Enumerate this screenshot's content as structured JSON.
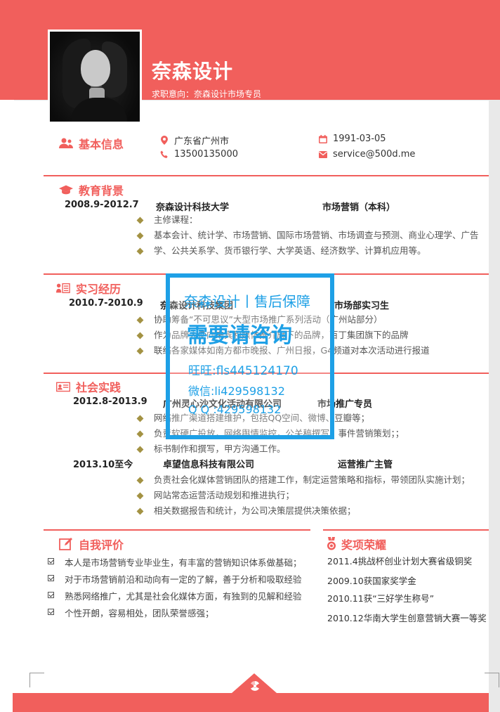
{
  "header": {
    "name": "奈森设计",
    "intent": "求职意向：奈森设计市场专员"
  },
  "colors": {
    "accent": "#f15f5c",
    "bullet": "#a39243",
    "watermark": "#1ea0e6"
  },
  "basic": {
    "title": "基本信息",
    "location": "广东省广州市",
    "birth": "1991-03-05",
    "phone": "13500135000",
    "email": "service@500d.me"
  },
  "education": {
    "title": "教育背景",
    "period": "2008.9-2012.7",
    "school": "奈森设计科技大学",
    "major": "市场营销（本科）",
    "bullets": [
      "主修课程：",
      "基本会计、统计学、市场营销、国际市场营销、市场调查与预测、商业心理学、广告",
      "学、公共关系学、货币银行学、大学英语、经济数学、计算机应用等。"
    ]
  },
  "internship": {
    "title": "实习经历",
    "period": "2010.7-2010.9",
    "company": "奈森设计科技集团",
    "role": "市场部实习生",
    "bullets": [
      "协助筹备“不可思议”大型市场推广系列活动（广州站部分）",
      "作为品牌大使向来宾和媒体推介旗下的品牌，百丁集团旗下的品牌",
      "联络各家媒体如南方都市晚报、广州日报，G4频道对本次活动进行报道"
    ]
  },
  "social": {
    "title": "社会实践",
    "jobs": [
      {
        "period": "2012.8-2013.9",
        "company": "广州灵心沙文化活动有限公司",
        "role": "市场推广专员",
        "bullets": [
          "网络推广渠道搭建维护，包括QQ空间、微博、豆瓣等；",
          "负责软硬广投放，网络舆情监控，公关稿撰写，事件营销策划；；",
          "标书制作和撰写，甲方沟通工作。"
        ]
      },
      {
        "period": "2013.10至今",
        "company": "卓望信息科技有限公司",
        "role": "运营推广主管",
        "bullets": [
          "负责社会化媒体营销团队的搭建工作，制定运营策略和指标，带领团队实施计划；",
          "网站常态运营活动规划和推进执行；",
          "相关数据报告和统计，为公司决策层提供决策依据；"
        ]
      }
    ]
  },
  "self_eval": {
    "title": "自我评价",
    "items": [
      "本人是市场营销专业毕业生，有丰富的营销知识体系做基础；",
      "对于市场营销前沿和动向有一定的了解，善于分析和吸取经验",
      "熟悉网络推广，尤其是社会化媒体方面，有独到的见解和经验",
      "个性开朗，容易相处，团队荣誉感强；"
    ]
  },
  "awards": {
    "title": "奖项荣耀",
    "items": [
      "2011.4挑战杯创业计划大赛省级铜奖",
      "2009.10获国家奖学金",
      "2010.11获“三好学生称号”",
      "2010.12华南大学生创意营销大赛一等奖"
    ]
  },
  "watermark": {
    "line1": "奈森设计丨售后保障",
    "line2": "需要请咨询",
    "line3": "旺旺:fls445124170",
    "line4": "微信:li429598132",
    "line5": "Q Q :429598132"
  }
}
